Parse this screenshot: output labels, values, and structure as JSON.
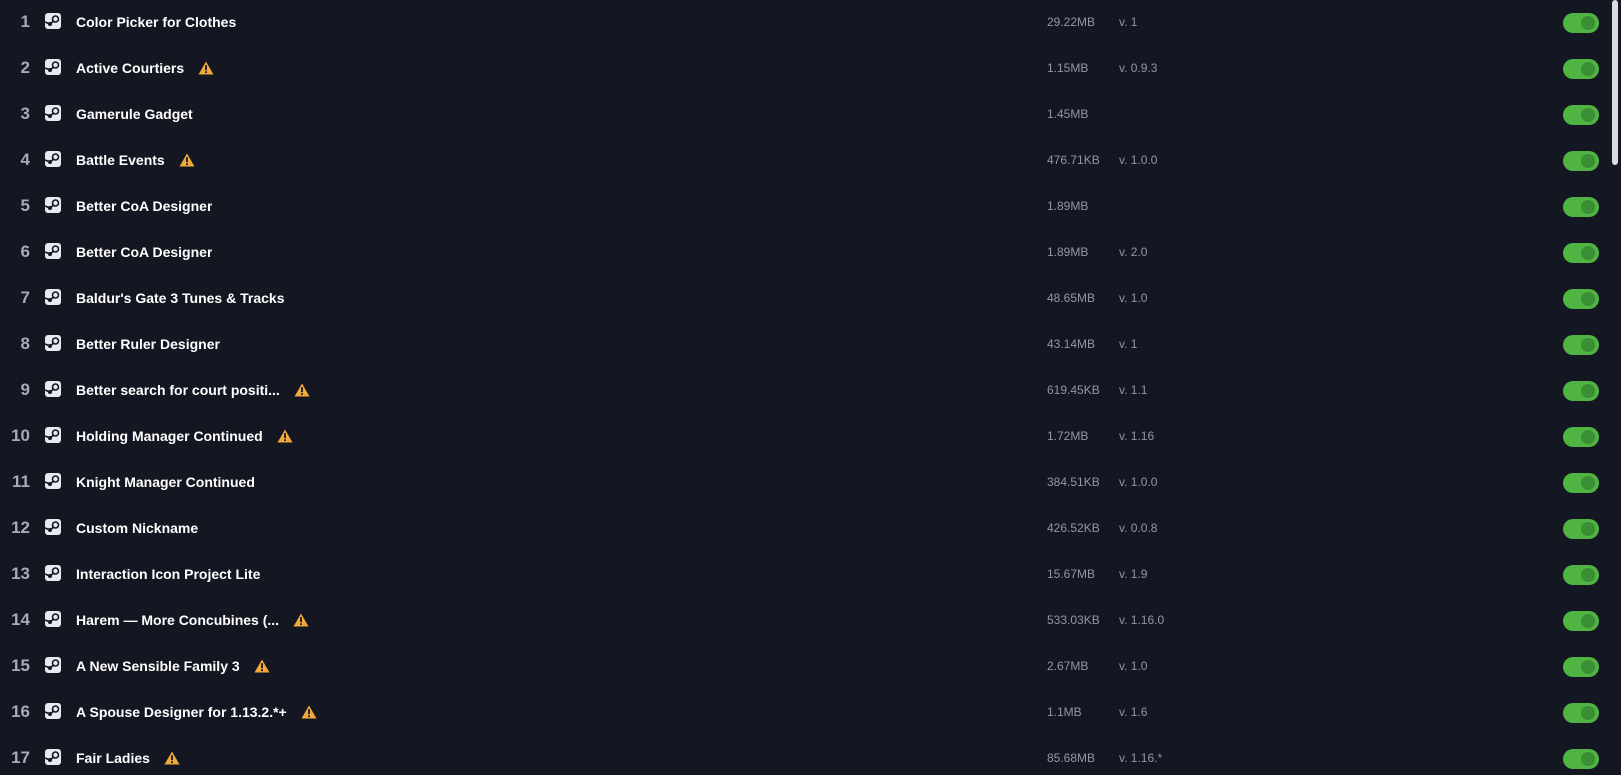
{
  "mods": [
    {
      "index": "1",
      "name": "Color Picker for Clothes",
      "warning": false,
      "size": "29.22MB",
      "version": "v. 1",
      "enabled": true
    },
    {
      "index": "2",
      "name": "Active Courtiers",
      "warning": true,
      "size": "1.15MB",
      "version": "v. 0.9.3",
      "enabled": true
    },
    {
      "index": "3",
      "name": "Gamerule Gadget",
      "warning": false,
      "size": "1.45MB",
      "version": "",
      "enabled": true
    },
    {
      "index": "4",
      "name": "Battle Events",
      "warning": true,
      "size": "476.71KB",
      "version": "v. 1.0.0",
      "enabled": true
    },
    {
      "index": "5",
      "name": "Better CoA Designer",
      "warning": false,
      "size": "1.89MB",
      "version": "",
      "enabled": true
    },
    {
      "index": "6",
      "name": "Better CoA Designer",
      "warning": false,
      "size": "1.89MB",
      "version": "v. 2.0",
      "enabled": true
    },
    {
      "index": "7",
      "name": "Baldur's Gate 3 Tunes & Tracks",
      "warning": false,
      "size": "48.65MB",
      "version": "v. 1.0",
      "enabled": true
    },
    {
      "index": "8",
      "name": "Better Ruler Designer",
      "warning": false,
      "size": "43.14MB",
      "version": "v. 1",
      "enabled": true
    },
    {
      "index": "9",
      "name": "Better search for court positi...",
      "warning": true,
      "size": "619.45KB",
      "version": "v. 1.1",
      "enabled": true
    },
    {
      "index": "10",
      "name": "Holding Manager Continued",
      "warning": true,
      "size": "1.72MB",
      "version": "v. 1.16",
      "enabled": true
    },
    {
      "index": "11",
      "name": "Knight Manager Continued",
      "warning": false,
      "size": "384.51KB",
      "version": "v. 1.0.0",
      "enabled": true
    },
    {
      "index": "12",
      "name": "Custom Nickname",
      "warning": false,
      "size": "426.52KB",
      "version": "v. 0.0.8",
      "enabled": true
    },
    {
      "index": "13",
      "name": "Interaction Icon Project Lite",
      "warning": false,
      "size": "15.67MB",
      "version": "v. 1.9",
      "enabled": true
    },
    {
      "index": "14",
      "name": "Harem — More Concubines (...",
      "warning": true,
      "size": "533.03KB",
      "version": "v. 1.16.0",
      "enabled": true
    },
    {
      "index": "15",
      "name": "A New Sensible Family 3",
      "warning": true,
      "size": "2.67MB",
      "version": "v. 1.0",
      "enabled": true
    },
    {
      "index": "16",
      "name": "A Spouse Designer for 1.13.2.*+",
      "warning": true,
      "size": "1.1MB",
      "version": "v. 1.6",
      "enabled": true
    },
    {
      "index": "17",
      "name": "Fair Ladies",
      "warning": true,
      "size": "85.68MB",
      "version": "v. 1.16.*",
      "enabled": true
    }
  ],
  "colors": {
    "background": "#141722",
    "toggle_on": "#4fb442",
    "warning": "#f0a93a"
  },
  "icons": {
    "source": "steam-icon",
    "warning": "warning-icon"
  }
}
